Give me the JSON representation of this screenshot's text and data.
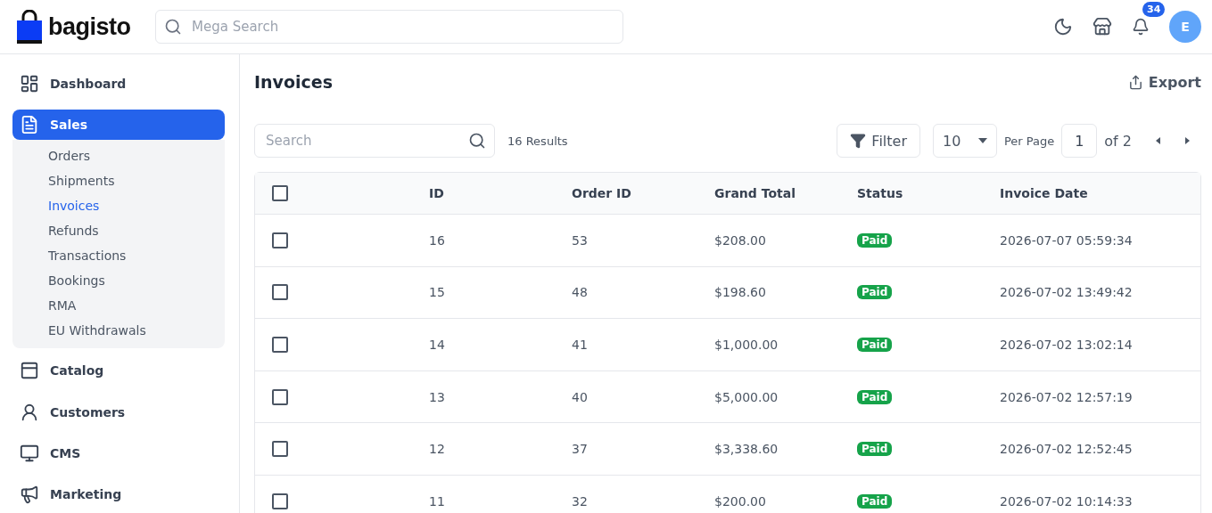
{
  "header": {
    "logo": "bagisto",
    "search": {
      "placeholder": "Mega Search"
    },
    "notifications": "34",
    "avatar": "E"
  },
  "sidebar": {
    "items": [
      {
        "label": "Dashboard",
        "selected": false
      },
      {
        "label": "Sales",
        "selected": true,
        "expanded": true,
        "children": [
          {
            "label": "Orders",
            "selected": false
          },
          {
            "label": "Shipments",
            "selected": false
          },
          {
            "label": "Invoices",
            "selected": true
          },
          {
            "label": "Refunds",
            "selected": false
          },
          {
            "label": "Transactions",
            "selected": false
          },
          {
            "label": "Bookings",
            "selected": false
          },
          {
            "label": "RMA",
            "selected": false
          },
          {
            "label": "EU Withdrawals",
            "selected": false
          }
        ]
      },
      {
        "label": "Catalog",
        "selected": false
      },
      {
        "label": "Customers",
        "selected": false
      },
      {
        "label": "CMS",
        "selected": false
      },
      {
        "label": "Marketing",
        "selected": false
      }
    ]
  },
  "page": {
    "title": "Invoices",
    "export": "Export"
  },
  "toolbar": {
    "search": {
      "placeholder": "Search"
    },
    "results": "16 Results",
    "filter": "Filter",
    "per_page": "10",
    "per_page_label": "Per Page",
    "page": "1",
    "of_pages": "of 2"
  },
  "table": {
    "select_all": {
      "checked": false
    },
    "columns": [
      "ID",
      "Order ID",
      "Grand Total",
      "Status",
      "Invoice Date"
    ],
    "rows": [
      {
        "checked": false,
        "cells": [
          "16",
          "53",
          "$208.00",
          "Paid",
          "2026-07-07 05:59:34"
        ]
      },
      {
        "checked": false,
        "cells": [
          "15",
          "48",
          "$198.60",
          "Paid",
          "2026-07-02 13:49:42"
        ]
      },
      {
        "checked": false,
        "cells": [
          "14",
          "41",
          "$1,000.00",
          "Paid",
          "2026-07-02 13:02:14"
        ]
      },
      {
        "checked": false,
        "cells": [
          "13",
          "40",
          "$5,000.00",
          "Paid",
          "2026-07-02 12:57:19"
        ]
      },
      {
        "checked": false,
        "cells": [
          "12",
          "37",
          "$3,338.60",
          "Paid",
          "2026-07-02 12:52:45"
        ]
      },
      {
        "checked": false,
        "cells": [
          "11",
          "32",
          "$200.00",
          "Paid",
          "2026-07-02 10:14:33"
        ]
      }
    ]
  }
}
